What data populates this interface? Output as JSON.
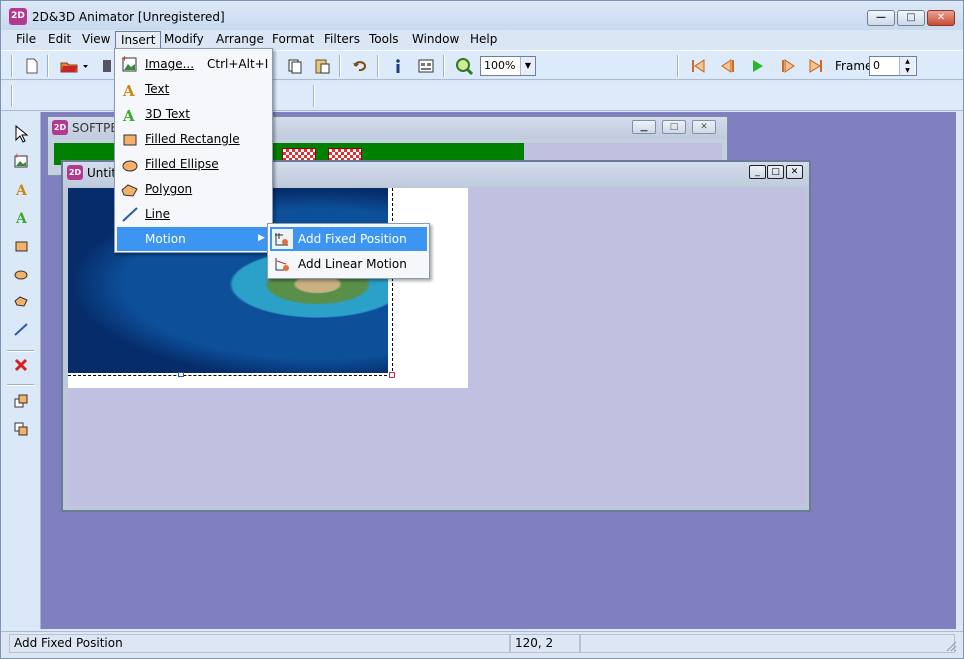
{
  "app": {
    "title": "2D&3D Animator [Unregistered]",
    "icon": "app-icon"
  },
  "window_controls": {
    "minimize": "—",
    "maximize": "□",
    "close": "✕"
  },
  "menubar": [
    "File",
    "Edit",
    "View",
    "Insert",
    "Modify",
    "Arrange",
    "Format",
    "Filters",
    "Tools",
    "Window",
    "Help"
  ],
  "toolbar": {
    "zoom": "100%",
    "frame_label": "Frame:",
    "frame_value": "0"
  },
  "insert_menu": {
    "items": [
      {
        "label": "Image...",
        "shortcut": "Ctrl+Alt+I",
        "icon": "image-icon"
      },
      {
        "label": "Text",
        "icon": "text-icon"
      },
      {
        "label": "3D Text",
        "icon": "3d-text-icon"
      },
      {
        "label": "Filled Rectangle",
        "icon": "rectangle-icon"
      },
      {
        "label": "Filled Ellipse",
        "icon": "ellipse-icon"
      },
      {
        "label": "Polygon",
        "icon": "polygon-icon"
      },
      {
        "label": "Line",
        "icon": "line-icon"
      },
      {
        "label": "Motion",
        "icon": "",
        "submenu": true
      }
    ]
  },
  "motion_submenu": {
    "items": [
      {
        "label": "Add Fixed Position",
        "icon": "fixed-position-icon"
      },
      {
        "label": "Add Linear Motion",
        "icon": "linear-motion-icon"
      }
    ]
  },
  "back_window": {
    "caption": "SOFTPE"
  },
  "front_window": {
    "caption": "Untit"
  },
  "status": {
    "message": "Add Fixed Position",
    "coords": "120, 2"
  },
  "colors": {
    "mdi_bg": "#8080c0",
    "canvas_bg": "#c0c0e0",
    "highlight": "#3d95f2",
    "stage_green": "#008000"
  }
}
